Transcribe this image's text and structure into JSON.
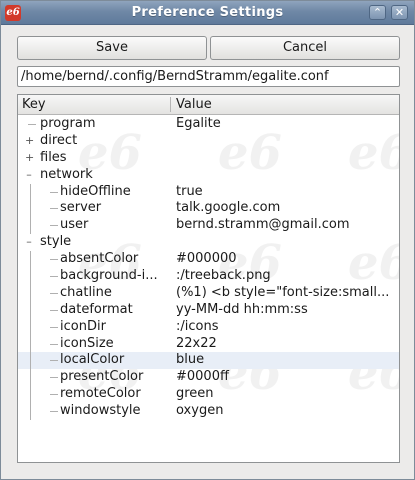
{
  "window": {
    "title": "Preference Settings",
    "app_icon_text": "e6",
    "up_button_glyph": "⌃",
    "close_button_glyph": "✕"
  },
  "toolbar": {
    "save_label": "Save",
    "cancel_label": "Cancel"
  },
  "path_field": {
    "value": "/home/bernd/.config/BerndStramm/egalite.conf"
  },
  "tree": {
    "headers": {
      "key": "Key",
      "value": "Value"
    },
    "watermark_text": "e6",
    "rows": [
      {
        "level": 0,
        "expander": "",
        "key": "program",
        "value": "Egalite"
      },
      {
        "level": 0,
        "expander": "+",
        "key": "direct",
        "value": ""
      },
      {
        "level": 0,
        "expander": "+",
        "key": "files",
        "value": ""
      },
      {
        "level": 0,
        "expander": "–",
        "key": "network",
        "value": ""
      },
      {
        "level": 1,
        "expander": "",
        "key": "hideOffline",
        "value": "true"
      },
      {
        "level": 1,
        "expander": "",
        "key": "server",
        "value": "talk.google.com"
      },
      {
        "level": 1,
        "expander": "",
        "key": "user",
        "value": "bernd.stramm@gmail.com"
      },
      {
        "level": 0,
        "expander": "–",
        "key": "style",
        "value": ""
      },
      {
        "level": 1,
        "expander": "",
        "key": "absentColor",
        "value": "#000000"
      },
      {
        "level": 1,
        "expander": "",
        "key": "background-i...",
        "value": ":/treeback.png"
      },
      {
        "level": 1,
        "expander": "",
        "key": "chatline",
        "value": "(%1) <b style=\"font-size:small..."
      },
      {
        "level": 1,
        "expander": "",
        "key": "dateformat",
        "value": "yy-MM-dd hh:mm:ss"
      },
      {
        "level": 1,
        "expander": "",
        "key": "iconDir",
        "value": ":/icons"
      },
      {
        "level": 1,
        "expander": "",
        "key": "iconSize",
        "value": "22x22"
      },
      {
        "level": 1,
        "expander": "",
        "key": "localColor",
        "value": "blue",
        "selected": true
      },
      {
        "level": 1,
        "expander": "",
        "key": "presentColor",
        "value": "#0000ff"
      },
      {
        "level": 1,
        "expander": "",
        "key": "remoteColor",
        "value": "green"
      },
      {
        "level": 1,
        "expander": "",
        "key": "windowstyle",
        "value": "oxygen"
      }
    ]
  },
  "colors": {
    "titlebar": "#6f88a6",
    "selection": "#e8eef7",
    "window_bg": "#ecebea"
  }
}
